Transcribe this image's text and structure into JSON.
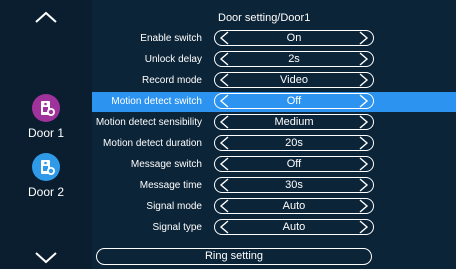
{
  "header": {
    "title": "Door setting/Door1"
  },
  "doors": [
    {
      "label": "Door 1",
      "color": "#a0339b"
    },
    {
      "label": "Door 2",
      "color": "#2f9be8"
    }
  ],
  "rows": [
    {
      "label": "Enable switch",
      "value": "On"
    },
    {
      "label": "Unlock delay",
      "value": "2s"
    },
    {
      "label": "Record mode",
      "value": "Video"
    },
    {
      "label": "Motion detect switch",
      "value": "Off"
    },
    {
      "label": "Motion detect sensibility",
      "value": "Medium"
    },
    {
      "label": "Motion detect duration",
      "value": "20s"
    },
    {
      "label": "Message switch",
      "value": "Off"
    },
    {
      "label": "Message time",
      "value": "30s"
    },
    {
      "label": "Signal mode",
      "value": "Auto"
    },
    {
      "label": "Signal type",
      "value": "Auto"
    }
  ],
  "footer": {
    "ring_label": "Ring setting"
  },
  "colors": {
    "highlight": "#2d93f0",
    "background": "#0c2437"
  }
}
